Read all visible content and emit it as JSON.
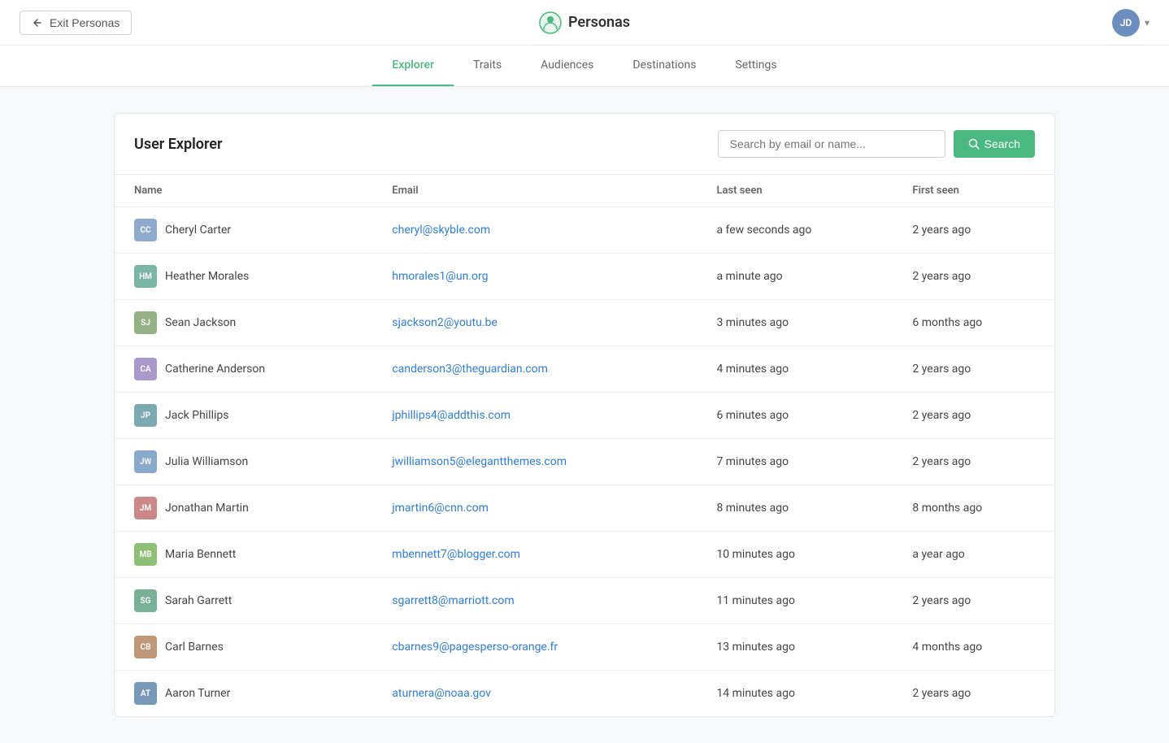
{
  "nav": {
    "exit_label": "Exit Personas",
    "brand_name": "Personas",
    "user_initials": "JD",
    "tabs": [
      {
        "id": "explorer",
        "label": "Explorer",
        "active": true
      },
      {
        "id": "traits",
        "label": "Traits",
        "active": false
      },
      {
        "id": "audiences",
        "label": "Audiences",
        "active": false
      },
      {
        "id": "destinations",
        "label": "Destinations",
        "active": false
      },
      {
        "id": "settings",
        "label": "Settings",
        "active": false
      }
    ]
  },
  "page": {
    "title": "User Explorer",
    "search_placeholder": "Search by email or name...",
    "search_button_label": "Search"
  },
  "table": {
    "columns": [
      {
        "id": "name",
        "label": "Name"
      },
      {
        "id": "email",
        "label": "Email"
      },
      {
        "id": "last_seen",
        "label": "Last seen"
      },
      {
        "id": "first_seen",
        "label": "First seen"
      }
    ],
    "rows": [
      {
        "initials": "CC",
        "color": "#a8b4c0",
        "name": "Cheryl Carter",
        "email": "cheryl@skyble.com",
        "last_seen": "a few seconds ago",
        "first_seen": "2 years ago"
      },
      {
        "initials": "HM",
        "color": "#a8b4c0",
        "name": "Heather Morales",
        "email": "hmorales1@un.org",
        "last_seen": "a minute ago",
        "first_seen": "2 years ago"
      },
      {
        "initials": "SJ",
        "color": "#a8b4c0",
        "name": "Sean Jackson",
        "email": "sjackson2@youtu.be",
        "last_seen": "3 minutes ago",
        "first_seen": "6 months ago"
      },
      {
        "initials": "CA",
        "color": "#a8b4c0",
        "name": "Catherine Anderson",
        "email": "canderson3@theguardian.com",
        "last_seen": "4 minutes ago",
        "first_seen": "2 years ago"
      },
      {
        "initials": "JP",
        "color": "#a8b4c0",
        "name": "Jack Phillips",
        "email": "jphillips4@addthis.com",
        "last_seen": "6 minutes ago",
        "first_seen": "2 years ago"
      },
      {
        "initials": "JW",
        "color": "#a8b4c0",
        "name": "Julia Williamson",
        "email": "jwilliamson5@elegantthemes.com",
        "last_seen": "7 minutes ago",
        "first_seen": "2 years ago"
      },
      {
        "initials": "JM",
        "color": "#a8b4c0",
        "name": "Jonathan Martin",
        "email": "jmartin6@cnn.com",
        "last_seen": "8 minutes ago",
        "first_seen": "8 months ago"
      },
      {
        "initials": "MB",
        "color": "#a8b4c0",
        "name": "Maria Bennett",
        "email": "mbennett7@blogger.com",
        "last_seen": "10 minutes ago",
        "first_seen": "a year ago"
      },
      {
        "initials": "SG",
        "color": "#a8b4c0",
        "name": "Sarah Garrett",
        "email": "sgarrett8@marriott.com",
        "last_seen": "11 minutes ago",
        "first_seen": "2 years ago"
      },
      {
        "initials": "CB",
        "color": "#a8b4c0",
        "name": "Carl Barnes",
        "email": "cbarnes9@pagesperso-orange.fr",
        "last_seen": "13 minutes ago",
        "first_seen": "4 months ago"
      },
      {
        "initials": "AT",
        "color": "#a8b4c0",
        "name": "Aaron Turner",
        "email": "aturnera@noaa.gov",
        "last_seen": "14 minutes ago",
        "first_seen": "2 years ago"
      }
    ]
  },
  "colors": {
    "CC": "#8faacc",
    "HM": "#8fb5a8",
    "SJ": "#a0b090",
    "CA": "#b0a8cc",
    "JP": "#8faab0",
    "JW": "#a8b8cc",
    "JM": "#cc9090",
    "MB": "#a8cc90",
    "SG": "#90b8a8",
    "CB": "#c0a890",
    "AT": "#90a8b8"
  }
}
